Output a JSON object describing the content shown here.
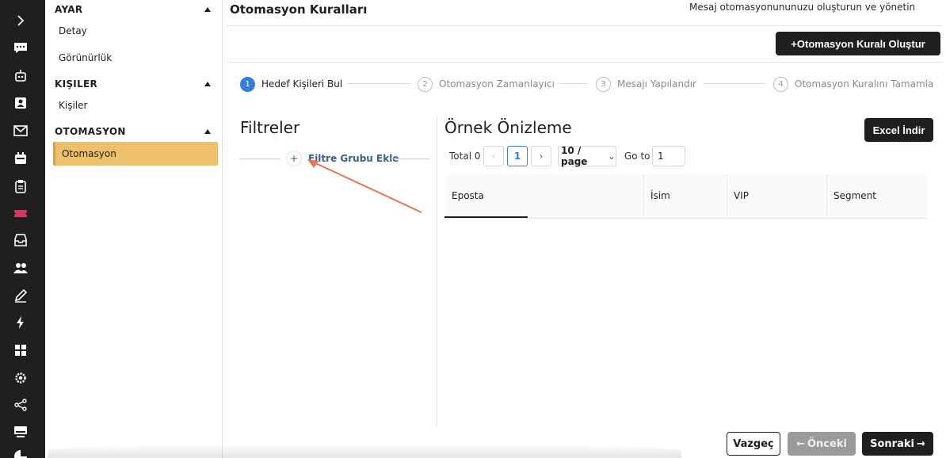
{
  "sidebar": {
    "sections": [
      {
        "title": "AYAR",
        "items": [
          "Detay",
          "Görünürlük"
        ]
      },
      {
        "title": "KIŞILER",
        "items": [
          "Kişiler"
        ]
      },
      {
        "title": "OTOMASYON",
        "items": [
          "Otomasyon"
        ]
      }
    ]
  },
  "header": {
    "title": "Otomasyon Kuralları",
    "subtitle": "Mesaj otomasyonununuzu oluşturun ve yönetin"
  },
  "create_button": "+Otomasyon Kuralı Oluştur",
  "steps": [
    {
      "num": "1",
      "label": "Hedef Kişileri Bul",
      "active": true
    },
    {
      "num": "2",
      "label": "Otomasyon Zamanlayıcı",
      "active": false
    },
    {
      "num": "3",
      "label": "Mesajı Yapılandır",
      "active": false
    },
    {
      "num": "4",
      "label": "Otomasyon Kuralını Tamamla",
      "active": false
    }
  ],
  "filters": {
    "heading": "Filtreler",
    "add_group": "Filtre Grubu Ekle"
  },
  "preview": {
    "heading": "Örnek Önizleme",
    "excel_button": "Excel İndir",
    "total": "Total 0",
    "current_page": "1",
    "page_size": "10 / page",
    "goto_label": "Go to",
    "goto_value": "1",
    "columns": [
      "Eposta",
      "İsim",
      "VIP",
      "Segment"
    ]
  },
  "footer": {
    "cancel": "Vazgeç",
    "prev": "Önceki",
    "next": "Sonraki"
  },
  "colors": {
    "active_sidebar": "#edc06c",
    "step_active": "#2f7fe0",
    "annotation_arrow": "#e8735a"
  },
  "rail_icons": [
    "chevron-right-icon",
    "chat-icon",
    "robot-icon",
    "contact-card-icon",
    "mail-icon",
    "calendar-icon",
    "clipboard-icon",
    "ticket-icon",
    "inbox-icon",
    "users-icon",
    "pen-icon",
    "lightning-icon",
    "grid-icon",
    "gear-icon",
    "share-icon",
    "keyboard-icon",
    "pie-chart-icon"
  ]
}
